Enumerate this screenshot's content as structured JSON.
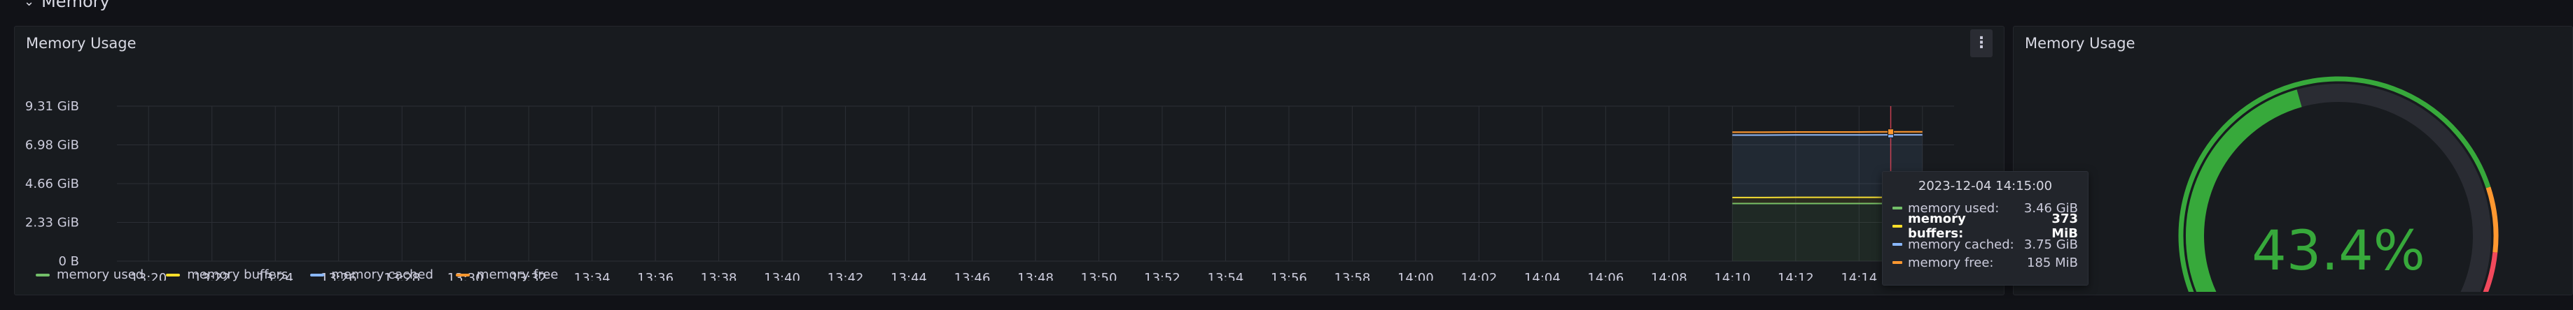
{
  "row": {
    "title": "Memory",
    "chevron_icon": "chevron-down-icon"
  },
  "panels": {
    "timeseries": {
      "title": "Memory Usage",
      "menu_icon": "kebab-menu-icon"
    },
    "gauge": {
      "title": "Memory Usage",
      "value_text": "43.4%",
      "value_fraction": 0.434
    }
  },
  "colors": {
    "used": "#73bf69",
    "buffers": "#fade2a",
    "cached": "#8ab8ff",
    "free": "#ff9830",
    "gauge_green": "#37a93b",
    "gauge_orange": "#ff9830",
    "gauge_red": "#f2495c"
  },
  "tooltip": {
    "time": "2023-12-04 14:15:00",
    "rows": [
      {
        "label": "memory used:",
        "value": "3.46 GiB",
        "color": "#73bf69",
        "bold": false
      },
      {
        "label": "memory buffers:",
        "value": "373 MiB",
        "color": "#fade2a",
        "bold": true
      },
      {
        "label": "memory cached:",
        "value": "3.75 GiB",
        "color": "#8ab8ff",
        "bold": false
      },
      {
        "label": "memory free:",
        "value": "185 MiB",
        "color": "#ff9830",
        "bold": false
      }
    ]
  },
  "legend": [
    {
      "label": "memory used",
      "color": "#73bf69"
    },
    {
      "label": "memory buffers",
      "color": "#fade2a"
    },
    {
      "label": "memory cached",
      "color": "#8ab8ff"
    },
    {
      "label": "memory free",
      "color": "#ff9830"
    }
  ],
  "chart_data": {
    "type": "area",
    "title": "Memory Usage",
    "y_ticks": [
      "0 B",
      "2.33 GiB",
      "4.66 GiB",
      "6.98 GiB",
      "9.31 GiB"
    ],
    "ylim": [
      0,
      9.31
    ],
    "y_unit": "GiB",
    "x_ticks": [
      "13:20",
      "13:22",
      "13:24",
      "13:26",
      "13:28",
      "13:30",
      "13:32",
      "13:34",
      "13:36",
      "13:38",
      "13:40",
      "13:42",
      "13:44",
      "13:46",
      "13:48",
      "13:50",
      "13:52",
      "13:54",
      "13:56",
      "13:58",
      "14:00",
      "14:02",
      "14:04",
      "14:06",
      "14:08",
      "14:10",
      "14:12",
      "14:14",
      "14:16"
    ],
    "xlim": [
      "13:19",
      "14:17"
    ],
    "hover_time": "14:15",
    "stacked": true,
    "x": [
      "14:10",
      "14:11",
      "14:12",
      "14:13",
      "14:14",
      "14:15",
      "14:16"
    ],
    "series": [
      {
        "name": "memory used",
        "values": [
          3.46,
          3.46,
          3.46,
          3.46,
          3.46,
          3.46,
          3.46
        ]
      },
      {
        "name": "memory buffers",
        "values": [
          0.36,
          0.36,
          0.37,
          0.37,
          0.37,
          0.373,
          0.373
        ]
      },
      {
        "name": "memory cached",
        "values": [
          3.75,
          3.75,
          3.75,
          3.75,
          3.75,
          3.75,
          3.75
        ]
      },
      {
        "name": "memory free",
        "values": [
          0.18,
          0.18,
          0.18,
          0.18,
          0.18,
          0.185,
          0.185
        ]
      }
    ],
    "legend_position": "bottom-left",
    "grid": true
  }
}
